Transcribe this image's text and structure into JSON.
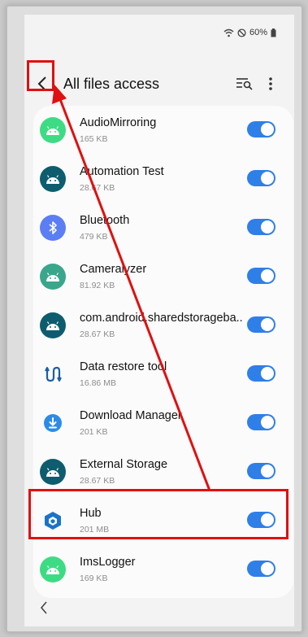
{
  "status": {
    "battery": "60%"
  },
  "header": {
    "title": "All files access"
  },
  "apps": [
    {
      "name": "AudioMirroring",
      "size": "165 KB",
      "icon": "android-green",
      "enabled": true
    },
    {
      "name": "Automation Test",
      "size": "28.67 KB",
      "icon": "android-teal",
      "enabled": true
    },
    {
      "name": "Bluetooth",
      "size": "479 KB",
      "icon": "bluetooth",
      "enabled": true
    },
    {
      "name": "Cameralyzer",
      "size": "81.92 KB",
      "icon": "android-green",
      "enabled": true
    },
    {
      "name": "com.android.sharedstorageba..",
      "size": "28.67 KB",
      "icon": "android-teal",
      "enabled": true
    },
    {
      "name": "Data restore tool",
      "size": "16.86 MB",
      "icon": "data-restore",
      "enabled": true
    },
    {
      "name": "Download Manager",
      "size": "201 KB",
      "icon": "download",
      "enabled": true
    },
    {
      "name": "External Storage",
      "size": "28.67 KB",
      "icon": "android-teal",
      "enabled": true
    },
    {
      "name": "Hub",
      "size": "201 MB",
      "icon": "hub",
      "enabled": true
    },
    {
      "name": "ImsLogger",
      "size": "169 KB",
      "icon": "android-green",
      "enabled": true
    }
  ],
  "colors": {
    "accent": "#2f7fe8",
    "highlight": "#e01010"
  }
}
